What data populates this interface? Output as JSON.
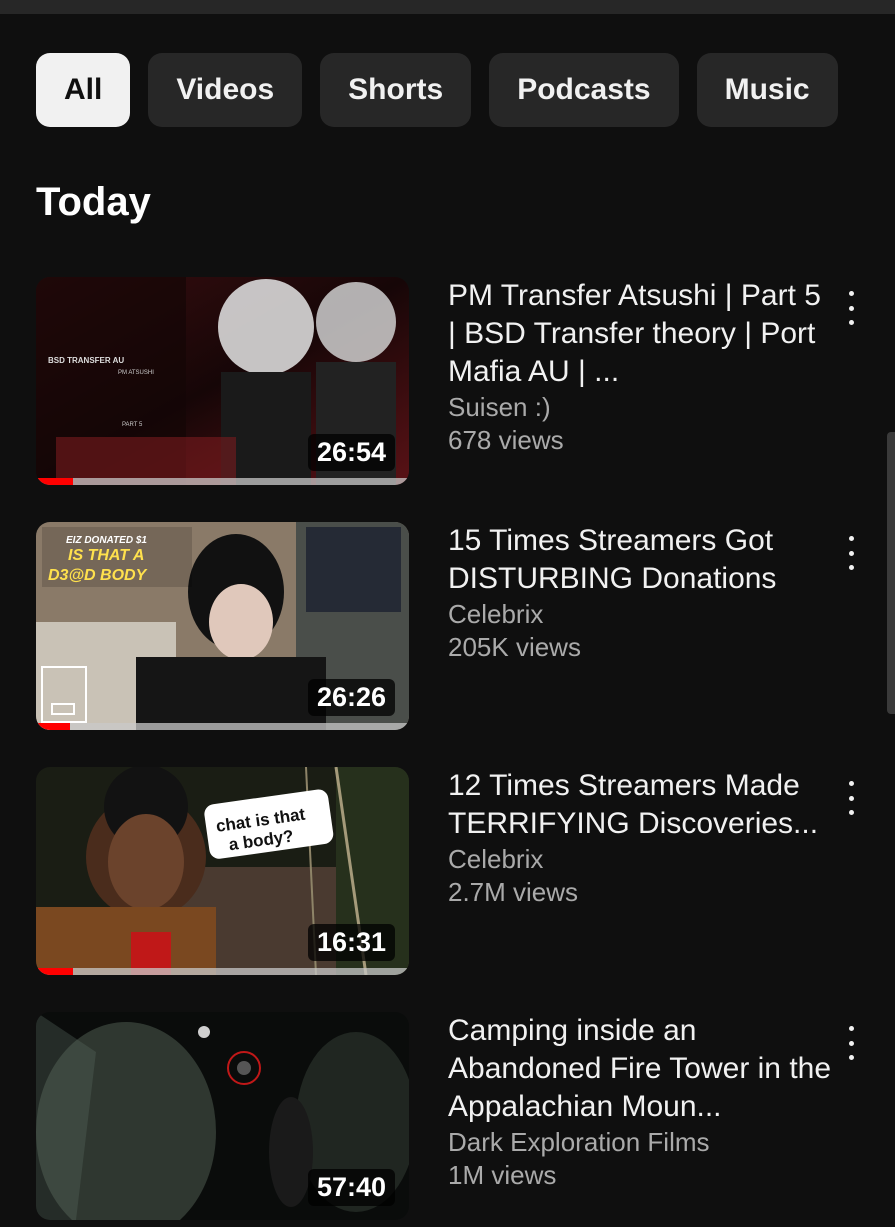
{
  "filters": {
    "chips": [
      {
        "label": "All",
        "active": true
      },
      {
        "label": "Videos",
        "active": false
      },
      {
        "label": "Shorts",
        "active": false
      },
      {
        "label": "Podcasts",
        "active": false
      },
      {
        "label": "Music",
        "active": false
      }
    ]
  },
  "section": {
    "title": "Today"
  },
  "videos": [
    {
      "title": "PM Transfer Atsushi | Part 5 | BSD Transfer theory | Port Mafia AU | ...",
      "channel": "Suisen :)",
      "views": "678 views",
      "duration": "26:54",
      "watched_fraction": 0.1,
      "thumb_text": {
        "line1": "BSD TRANSFER AU",
        "line2": "PM ATSUSHI",
        "line3": "PART 5"
      }
    },
    {
      "title": "15 Times Streamers Got DISTURBING Donations",
      "channel": "Celebrix",
      "views": "205K views",
      "duration": "26:26",
      "watched_fraction": 0.09,
      "thumb_text": {
        "line1": "EIZ DONATED $1",
        "line2": "IS THAT A",
        "line3": "D3@D BODY"
      }
    },
    {
      "title": "12 Times Streamers Made TERRIFYING Discoveries...",
      "channel": "Celebrix",
      "views": "2.7M views",
      "duration": "16:31",
      "watched_fraction": 0.1,
      "thumb_text": {
        "line1": "chat is that",
        "line2": "a body?"
      }
    },
    {
      "title": "Camping inside an Abandoned Fire Tower in the Appalachian Moun...",
      "channel": "Dark Exploration Films",
      "views": "1M views",
      "duration": "57:40",
      "watched_fraction": 0,
      "thumb_text": {}
    }
  ],
  "colors": {
    "background": "#0f0f0f",
    "chip": "#272727",
    "chip_active": "#f1f1f1",
    "progress": "#ff0000",
    "secondary_text": "#aaaaaa"
  },
  "icons": {
    "more": "more-vert-icon"
  }
}
